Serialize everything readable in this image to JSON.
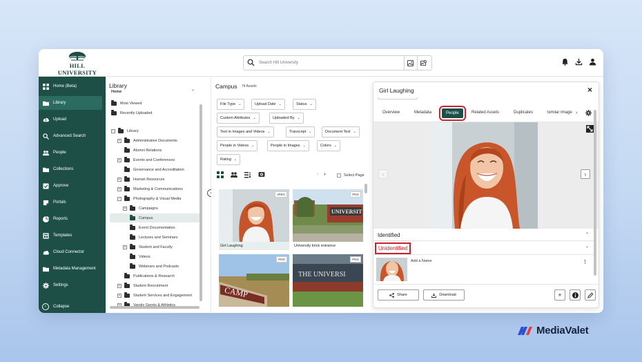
{
  "header": {
    "logo_name": "HILL UNIVERSITY",
    "logo_est": "EST. 1864",
    "search_placeholder": "Search Hill University"
  },
  "sidebar": {
    "items": [
      {
        "label": "Home (Beta)",
        "icon": "home-icon"
      },
      {
        "label": "Library",
        "icon": "folder-icon"
      },
      {
        "label": "Upload",
        "icon": "upload-icon"
      },
      {
        "label": "Advanced Search",
        "icon": "advanced-search-icon"
      },
      {
        "label": "People",
        "icon": "people-icon"
      },
      {
        "label": "Collections",
        "icon": "collections-icon"
      },
      {
        "label": "Approve",
        "icon": "approve-icon"
      },
      {
        "label": "Portals",
        "icon": "portals-icon"
      },
      {
        "label": "Reports",
        "icon": "reports-icon"
      },
      {
        "label": "Templates",
        "icon": "templates-icon"
      },
      {
        "label": "Cloud Connector",
        "icon": "cloud-icon"
      },
      {
        "label": "Metadata Management",
        "icon": "metadata-icon"
      },
      {
        "label": "Settings",
        "icon": "gear-icon"
      }
    ],
    "collapse_label": "Collapse"
  },
  "library": {
    "title": "Library",
    "subtitle": "Home",
    "quick": [
      "Most Viewed",
      "Recently Uploaded"
    ],
    "tree": [
      {
        "label": "Library",
        "box": "−"
      },
      {
        "label": "Administrative Documents",
        "box": "+"
      },
      {
        "label": "Alumni Relations",
        "box": ""
      },
      {
        "label": "Events and Conferences",
        "box": "+"
      },
      {
        "label": "Governance and Accreditation",
        "box": ""
      },
      {
        "label": "Human Resources",
        "box": "+"
      },
      {
        "label": "Marketing & Communications",
        "box": "+"
      },
      {
        "label": "Photography & Visual Media",
        "box": "−"
      },
      {
        "label": "Campaigns",
        "box": "+"
      },
      {
        "label": "Campus",
        "box": ""
      },
      {
        "label": "Event Documentation",
        "box": ""
      },
      {
        "label": "Lectures and Seminars",
        "box": ""
      },
      {
        "label": "Student and Faculty",
        "box": "+"
      },
      {
        "label": "Videos",
        "box": ""
      },
      {
        "label": "Webinars and Podcasts",
        "box": ""
      },
      {
        "label": "Publications & Research",
        "box": ""
      },
      {
        "label": "Student Recruitment",
        "box": "+"
      },
      {
        "label": "Student Services and Engagement",
        "box": "+"
      },
      {
        "label": "Varsity Sports & Athletics",
        "box": "+"
      }
    ]
  },
  "campus": {
    "title": "Campus",
    "count": "74 Assets",
    "filters": [
      "File Type",
      "Upload Date",
      "Status",
      "Custom Attributes",
      "Uploaded By",
      "Text in Images and Videos",
      "Transcript",
      "Document Text",
      "People in Videos",
      "People in Images",
      "Colors",
      "Rating"
    ],
    "select_page": "Select Page",
    "assets": [
      {
        "caption": "Girl Laughing",
        "badge": "JPEG"
      },
      {
        "caption": "University brick entrance",
        "badge": "PNG"
      },
      {
        "caption": "",
        "badge": "PNG"
      },
      {
        "caption": "",
        "badge": "PNG"
      }
    ]
  },
  "detail": {
    "title": "Girl Laughing",
    "tabs": [
      "Overview",
      "Metadata",
      "People",
      "Related Assets",
      "Duplicates",
      "Similar Images"
    ],
    "identified": "Identified",
    "unidentified": "Unidentified",
    "add_name": "Add a Name",
    "share": "Share",
    "download": "Download"
  },
  "brand": {
    "name": "MediaValet"
  },
  "colors": {
    "sidebar": "#1d4f47",
    "highlight": "#c8242f",
    "accent": "#2c6b60"
  }
}
